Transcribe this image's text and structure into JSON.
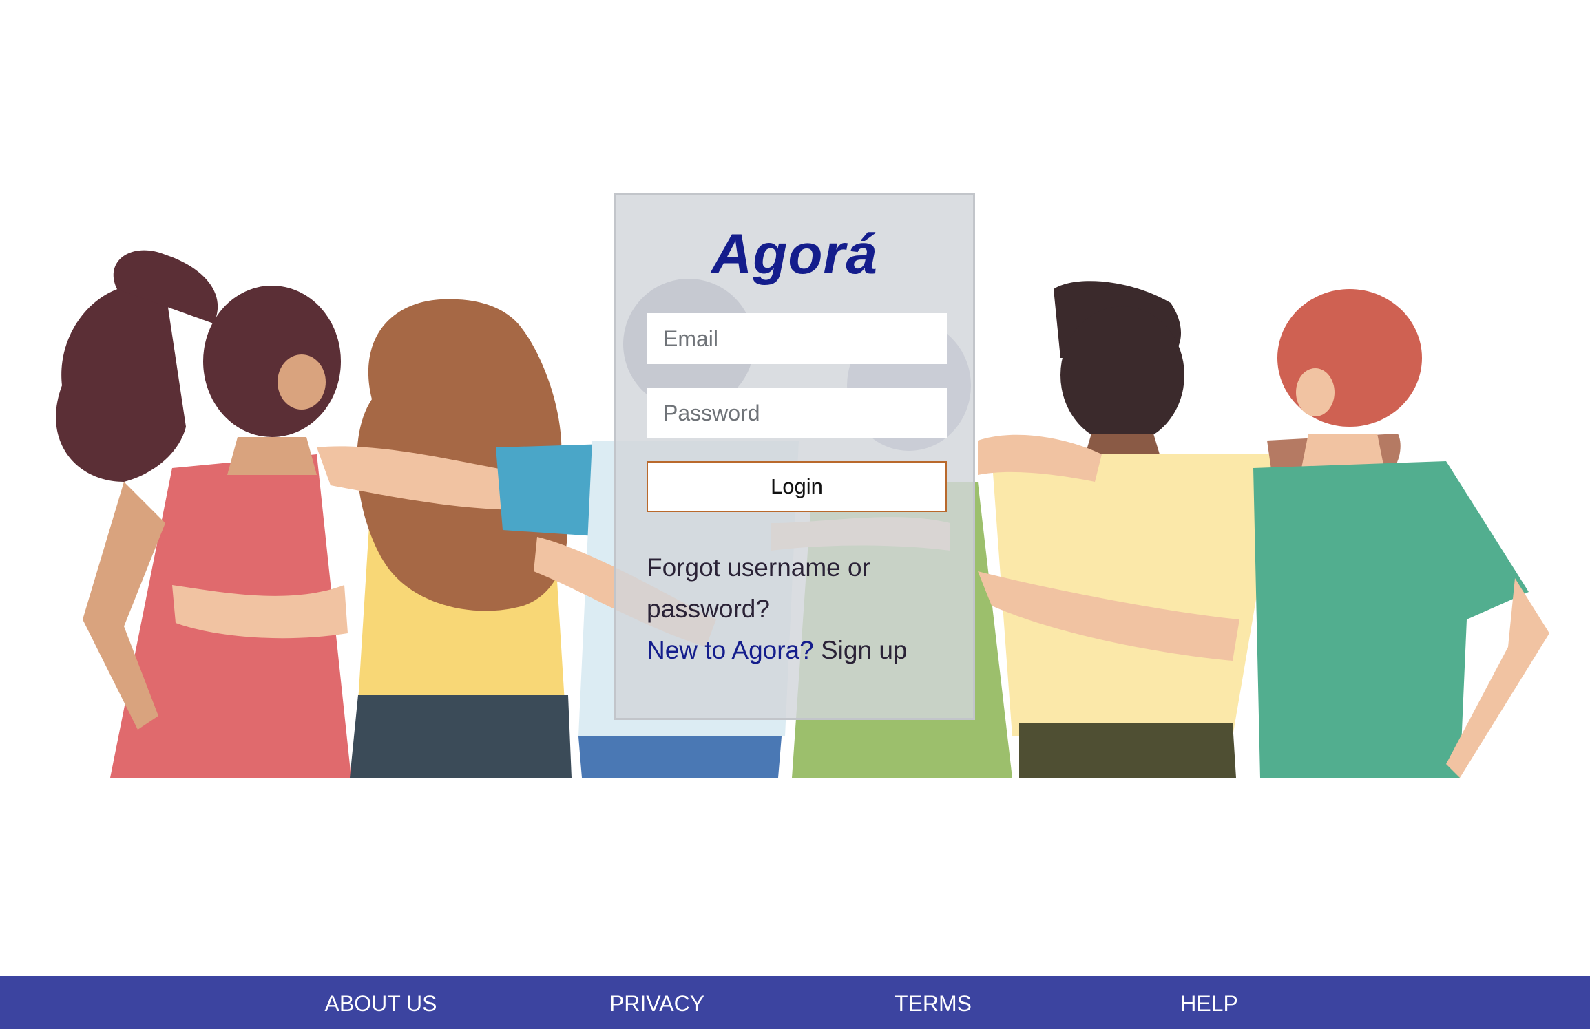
{
  "brand": {
    "name": "Agorá",
    "color": "#141d8c"
  },
  "login": {
    "email_placeholder": "Email",
    "password_placeholder": "Password",
    "login_label": "Login",
    "forgot_label": "Forgot username or password?",
    "new_to_label": "New to Agora?",
    "signup_label": "Sign up"
  },
  "footer": {
    "background": "#3c44a0",
    "links": [
      {
        "label": "ABOUT US"
      },
      {
        "label": "PRIVACY"
      },
      {
        "label": "TERMS"
      },
      {
        "label": "HELP"
      }
    ]
  },
  "illustration": {
    "description_icon": "group-of-friends-hugging-illustration"
  }
}
